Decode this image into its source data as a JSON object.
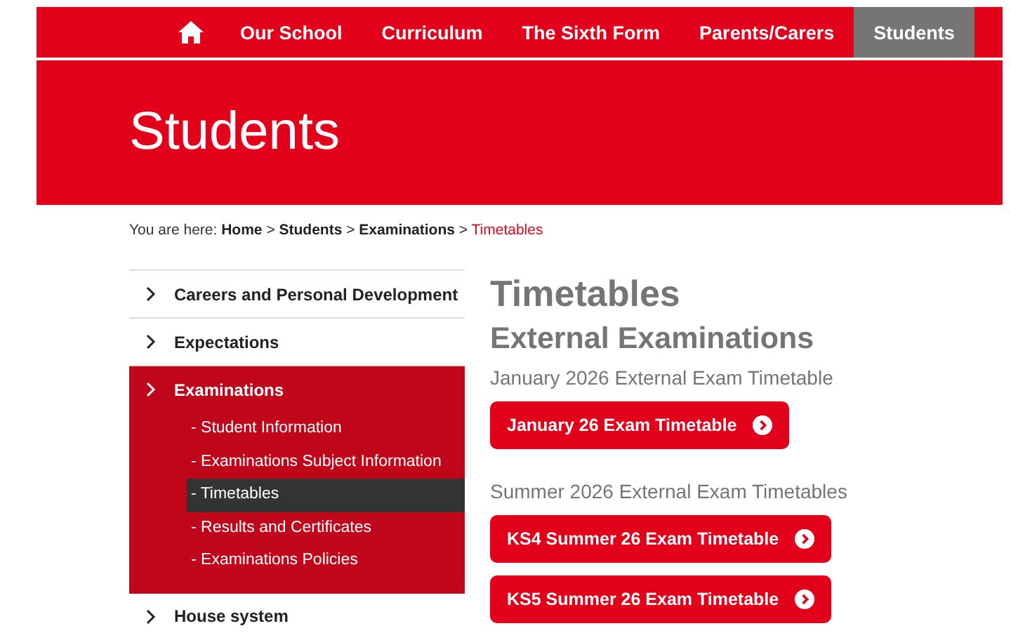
{
  "nav": {
    "items": [
      {
        "kind": "home",
        "selected": false
      },
      {
        "kind": "link",
        "label": "Our School",
        "selected": false
      },
      {
        "kind": "link",
        "label": "Curriculum",
        "selected": false
      },
      {
        "kind": "link",
        "label": "The Sixth Form",
        "selected": false
      },
      {
        "kind": "link",
        "label": "Parents/Carers",
        "selected": false
      },
      {
        "kind": "link",
        "label": "Students",
        "selected": true
      }
    ]
  },
  "banner": {
    "title": "Students"
  },
  "breadcrumb": {
    "prefix": "You are here:",
    "crumbs": [
      {
        "label": "Home",
        "separator": ">"
      },
      {
        "label": "Students",
        "separator": ">"
      },
      {
        "label": "Examinations",
        "separator": ">"
      }
    ],
    "current": "Timetables"
  },
  "sidebar": {
    "items": [
      {
        "label": "Careers and Personal Development",
        "selected": false
      },
      {
        "label": "Expectations",
        "selected": false
      },
      {
        "label": "Examinations",
        "selected": true,
        "expanded": true,
        "children": [
          {
            "label": "- Student Information",
            "selected": false
          },
          {
            "label": "- Examinations Subject Information",
            "selected": false
          },
          {
            "label": "- Timetables",
            "selected": true
          },
          {
            "label": "- Results and Certificates",
            "selected": false
          },
          {
            "label": "- Examinations Policies",
            "selected": false
          }
        ]
      },
      {
        "label": "House system",
        "selected": false
      }
    ]
  },
  "content": {
    "title": "Timetables",
    "subtitle": "External Examinations",
    "sections": [
      {
        "heading": "January 2026 External Exam Timetable",
        "buttons": [
          {
            "label": "January 26 Exam Timetable"
          }
        ]
      },
      {
        "heading": "Summer 2026 External Exam Timetables",
        "buttons": [
          {
            "label": "KS4 Summer 26 Exam Timetable"
          },
          {
            "label": "KS5 Summer 26 Exam Timetable"
          }
        ]
      }
    ]
  }
}
